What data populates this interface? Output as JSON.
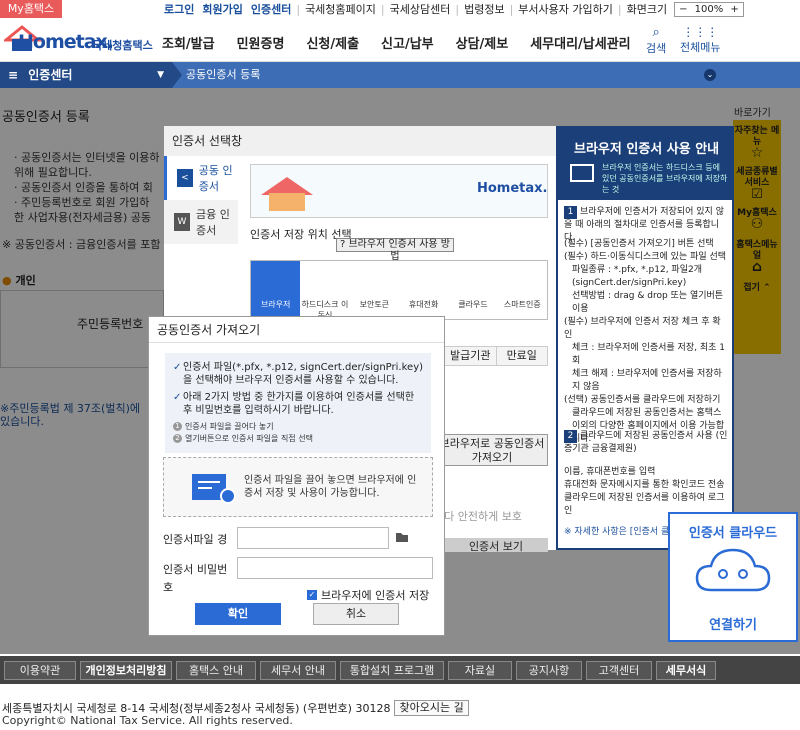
{
  "top": {
    "my_hometax": "My홈택스",
    "links": [
      "로그인",
      "회원가입",
      "인증센터",
      "국세청홈페이지",
      "국세상담센터",
      "법령정보",
      "부서사용자 가입하기",
      "화면크기"
    ],
    "zoom": "100%"
  },
  "header": {
    "logo": "Hometax.",
    "logo_sub": "국세청홈택스",
    "gnb": [
      "조회/발급",
      "민원증명",
      "신청/제출",
      "신고/납부",
      "상담/제보",
      "세무대리/납세관리"
    ],
    "search_label": "검색",
    "menu_label": "전체메뉴"
  },
  "navbar": {
    "menu": "인증센터",
    "crumb": "공동인증서 등록"
  },
  "page": {
    "title": "공동인증서 등록",
    "bullets": [
      "· 공동인증서는 인터넷을 이용하",
      "  위해 필요합니다.",
      "· 공동인증서 인증을 통하여 회",
      "· 주민등록번호로 회원 가입하",
      "  한 사업자용(전자세금용) 공동"
    ],
    "note1": "※ 공동인증서 : 금융인증서를 포함",
    "indiv": "개인",
    "resident_no": "주민등록번호",
    "note2_line1": "※주민등록법 제 37조(벌칙)에",
    "note2_line2": "  있습니다."
  },
  "quick": {
    "label": "바로가기",
    "items": [
      "자주찾는 메뉴",
      "세금종류별 서비스",
      "My홈택스",
      "홈택스메뉴얼",
      "접기"
    ]
  },
  "certwin": {
    "title": "인증서 선택창",
    "tab1": "공동 인증서",
    "tab2": "금융 인증서",
    "loc_title": "인증서 저장 위치 선택",
    "browser_btn": "브라우저 인증서 사용 방법",
    "locations": [
      "브라우저",
      "하드디스크 이동식",
      "보안토큰",
      "휴대전화",
      "클라우드",
      "스마트인증"
    ],
    "col_issuer": "발급기관",
    "col_expire": "만료일",
    "cloud_btn": "브라우저로 공동인증서 가져오기",
    "safe": "보다 안전하게 보호",
    "see": "인증서 보기"
  },
  "bpanel": {
    "title": "브라우저 인증서 사용 안내",
    "desc": "브라우저 인증서는 하드디스크 등에 있던 공동인증서를 브라우저에 저장하는 것",
    "step1": "브라우저에 인증서가 저장되어 있지 않을 때 아래의 절차대로 인증서를 등록합니다.",
    "lines": [
      "(필수) [공동인증서 가져오기] 버튼 선택",
      "(필수) 하드·이동식디스크에 있는 파일 선택",
      "파일종류 : *.pfx, *.p12, 파일2개 (signCert.der/signPri.key)",
      "선택방법 : drag & drop 또는 열기버튼 이용",
      "(필수) 브라우저에 인증서 저장 체크 후 확인",
      "체크 : 브라우저에 인증서를 저장, 최초 1회",
      "체크 해제 : 브라우저에 인증서를 저장하지 않음",
      "(선택) 공동인증서를 클라우드에 저장하기",
      "클라우드에 저장된 공동인증서는 홈택스 이외의 다양한 홈페이지에서 이용 가능합니다."
    ],
    "step2": "클라우드에 저장된 공동인증서 사용 (인증기관 금융결제원)",
    "lines2": [
      "이름, 휴대폰번호를 입력",
      "휴대전화 문자메시지를 통한 확인코드 전송",
      "클라우드에 저장된 인증서를 이용하여 로그인"
    ],
    "more": "※ 자세한 사항은 [인증서 클라우드]"
  },
  "cloud": {
    "title": "인증서 클라우드",
    "action": "연결하기"
  },
  "modal": {
    "title": "공동인증서 가져오기",
    "check1": "인증서 파일(*.pfx, *.p12, signCert.der/signPri.key)을 선택해야 브라우저 인증서를 사용할 수 있습니다.",
    "check2": "아래 2가지 방법 중 한가지를 이용하여 인증서를 선택한 후 비밀번호를 입력하시기 바랍니다.",
    "sub1": "인증서 파일을 끌어다 놓기",
    "sub2": "열기버튼으로 인증서 파일을 직접 선택",
    "drop_text": "인증서 파일을 끌어 놓으면 브라우저에 인증서 저장 및 사용이 가능합니다.",
    "file_label": "인증서파일 경",
    "pw_label1": "인증서 비밀번",
    "pw_label2": "호",
    "file_value": "",
    "pw_value": "",
    "save_label": "브라우저에 인증서 저장",
    "ok": "확인",
    "cancel": "취소"
  },
  "footer": {
    "buttons": [
      "이용약관",
      "개인정보처리방침",
      "홈택스 안내",
      "세무서 안내",
      "통합설치 프로그램",
      "자료실",
      "공지사항",
      "고객센터",
      "세무서식"
    ],
    "address": "세종특별자치시 국세청로 8-14 국세청(정부세종2청사 국세청동) (우편번호) 30128",
    "find": "찾아오시는 길",
    "copyright": "Copyright© National Tax Service. All rights reserved."
  },
  "colors": {
    "primary": "#1a4f9c",
    "nav": "#3d6db5",
    "accent_yellow": "#f7c800",
    "button_blue": "#2b6bd6"
  }
}
